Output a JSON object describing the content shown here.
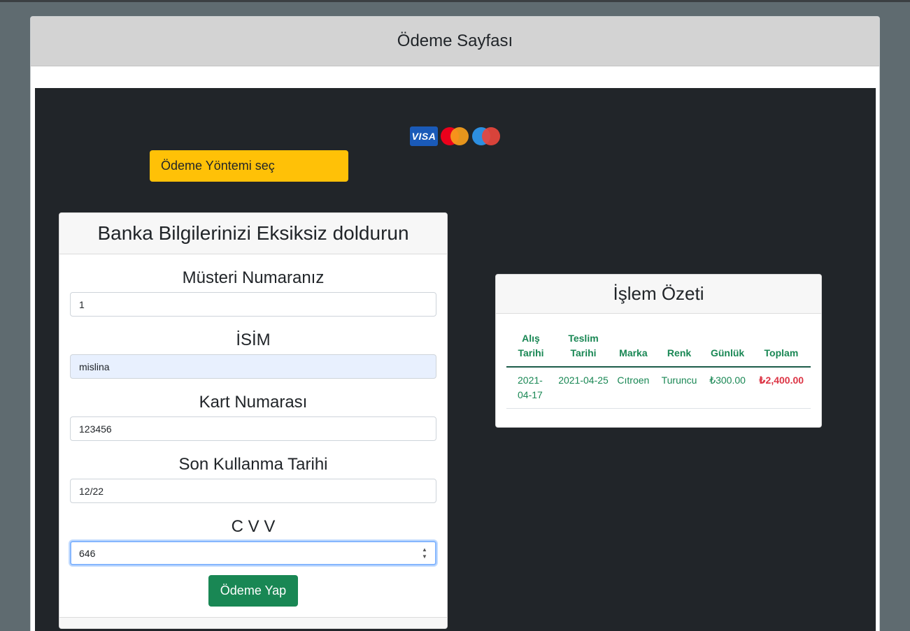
{
  "page": {
    "title": "Ödeme Sayfası"
  },
  "payment_icons": [
    "visa-icon",
    "mastercard-icon",
    "maestro-icon"
  ],
  "payment_icon_labels": {
    "visa": "VISA"
  },
  "method_button": {
    "label": "Ödeme Yöntemi seç"
  },
  "bank_form": {
    "title": "Banka Bilgilerinizi Eksiksiz doldurun",
    "fields": [
      {
        "label": "Müsteri Numaranız",
        "value": "1"
      },
      {
        "label": "İSİM",
        "value": "mislina"
      },
      {
        "label": "Kart Numarası",
        "value": "123456"
      },
      {
        "label": "Son Kullanma Tarihi",
        "value": "12/22"
      },
      {
        "label": "C V V",
        "value": "646"
      }
    ],
    "submit_label": "Ödeme Yap"
  },
  "summary": {
    "title": "İşlem Özeti",
    "columns": [
      "Alış Tarihi",
      "Teslim Tarihi",
      "Marka",
      "Renk",
      "Günlük",
      "Toplam"
    ],
    "rows": [
      [
        "2021-04-17",
        "2021-04-25",
        "Cıtroen",
        "Turuncu",
        "₺300.00",
        "₺2,400.00"
      ]
    ]
  },
  "colors": {
    "background": "#5f6b70",
    "dark_panel": "#212529",
    "warning": "#ffc107",
    "success": "#198754",
    "danger": "#dc3545"
  }
}
